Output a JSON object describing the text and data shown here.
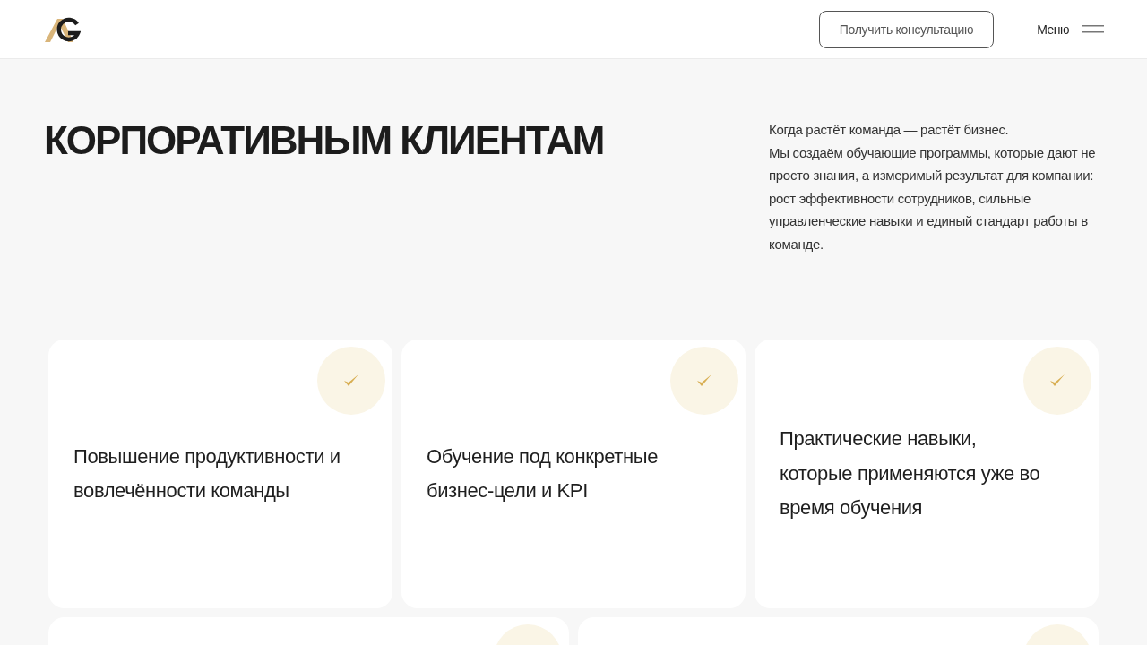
{
  "header": {
    "cta": "Получить консультацию",
    "menu": "Меню"
  },
  "hero": {
    "title": "КОРПОРАТИВНЫМ КЛИЕНТАМ",
    "intro": "Когда растёт команда — растёт бизнес.",
    "text": "Мы создаём обучающие программы, которые дают не просто знания, а измеримый результат для компании: рост эффективности сотрудников, сильные управленческие навыки и единый стандарт работы в команде."
  },
  "cards": [
    {
      "kind": "check",
      "text": "Повышение продуктивности и вовлечённости команды"
    },
    {
      "kind": "check",
      "text": "Обучение под конкретные бизнес-цели и KPI"
    },
    {
      "kind": "check",
      "text": "Практические навыки, которые применяются уже во время обучения"
    },
    {
      "kind": "badge"
    },
    {
      "kind": "badge"
    }
  ]
}
